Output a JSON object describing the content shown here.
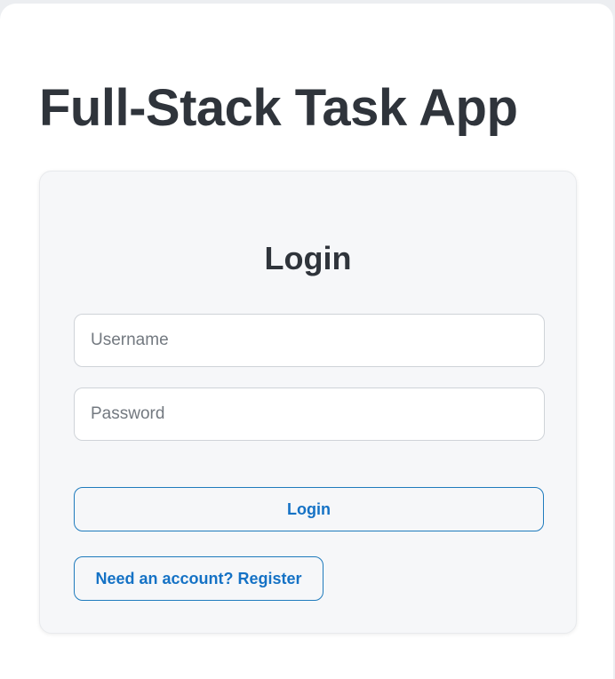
{
  "app": {
    "title": "Full-Stack Task App"
  },
  "login_form": {
    "heading": "Login",
    "username": {
      "placeholder": "Username",
      "value": ""
    },
    "password": {
      "placeholder": "Password",
      "value": ""
    },
    "login_button_label": "Login",
    "register_link_label": "Need an account? Register"
  },
  "colors": {
    "page_background": "#ffffff",
    "card_background": "#f6f7f9",
    "text_primary": "#2f343b",
    "accent": "#1572c5",
    "input_border": "#cfd3d8"
  }
}
